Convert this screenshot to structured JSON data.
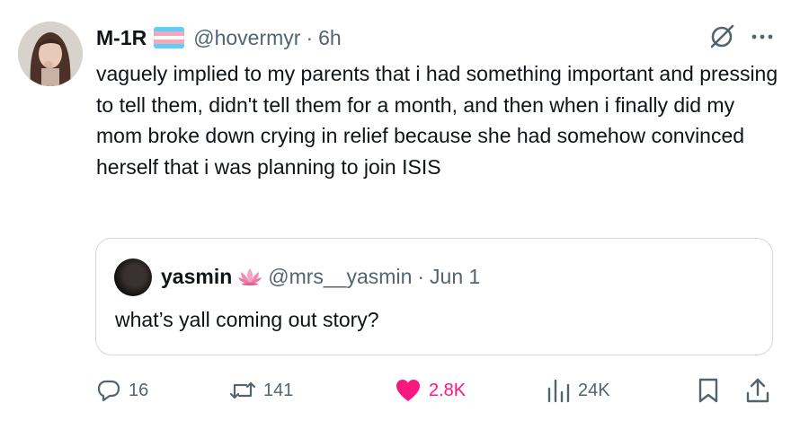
{
  "author": {
    "display_name": "M-1R",
    "flag_colors": [
      "#5BCEFA",
      "#F5A9B8",
      "#FFFFFF",
      "#F5A9B8",
      "#5BCEFA"
    ],
    "handle": "@hovermyr",
    "separator": "·",
    "time": "6h"
  },
  "tweet_text": "vaguely implied to my parents that i had something important and pressing to tell them, didn't tell them for a month, and then when i finally did my mom broke down crying in relief because she had somehow convinced herself that i was planning to join ISIS",
  "quoted": {
    "display_name": "yasmin",
    "emoji_icon": "lotus-icon",
    "handle": "@mrs__yasmin",
    "separator": "·",
    "date": "Jun 1",
    "text": "what’s yall coming out story?"
  },
  "actions": {
    "reply_count": "16",
    "repost_count": "141",
    "like_count": "2.8K",
    "view_count": "24K"
  },
  "colors": {
    "text_primary": "#0f1419",
    "text_secondary": "#536471",
    "like_pink": "#f91880",
    "border": "#cfd9de"
  }
}
